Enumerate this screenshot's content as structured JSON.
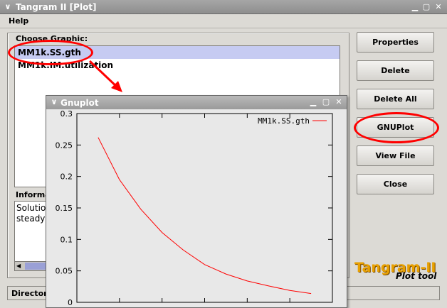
{
  "window": {
    "title": "Tangram II [Plot]"
  },
  "menu": {
    "help": "Help"
  },
  "graphics": {
    "label": "Choose Graphic:",
    "items": [
      "MM1k.SS.gth",
      "MM1k.IM.utilization"
    ]
  },
  "info": {
    "label": "Information",
    "lines": [
      "Solution",
      "steady"
    ]
  },
  "buttons": {
    "properties": "Properties",
    "delete": "Delete",
    "delete_all": "Delete All",
    "gnuplot": "GNUPlot",
    "view_file": "View File",
    "close": "Close"
  },
  "directory": {
    "label": "Directory"
  },
  "logo": {
    "main": "Tangram-II",
    "sub": "Plot tool"
  },
  "gnuplot_window": {
    "title": "Gnuplot"
  },
  "chart_data": {
    "type": "line",
    "title": "",
    "xlabel": "",
    "ylabel": "",
    "yticks": [
      "0.3",
      "0.25",
      "0.2",
      "0.15",
      "0.1",
      "0.05",
      "0"
    ],
    "ylim": [
      0,
      0.3
    ],
    "xlim": [
      0,
      6
    ],
    "series": [
      {
        "name": "MM1k.SS.gth",
        "color": "#ff0000",
        "x": [
          0.5,
          1,
          1.5,
          2,
          2.5,
          3,
          3.5,
          4,
          4.5,
          5,
          5.5
        ],
        "values": [
          0.262,
          0.195,
          0.148,
          0.111,
          0.083,
          0.06,
          0.045,
          0.034,
          0.026,
          0.019,
          0.014
        ]
      }
    ],
    "legend_position": "top-right"
  }
}
